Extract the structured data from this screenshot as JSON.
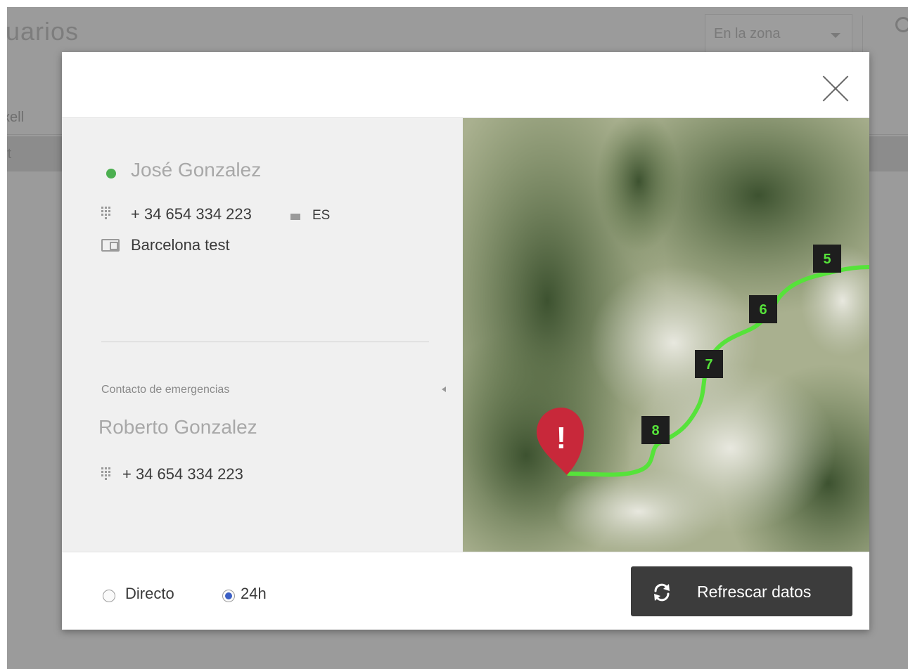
{
  "background": {
    "title": "uarios",
    "zone_select": "En la zona",
    "rows": [
      "xell",
      "rt"
    ]
  },
  "modal": {
    "user": {
      "name": "José Gonzalez",
      "status_color": "#4caf50",
      "phone": "+ 34 654 334 223",
      "country": "ES",
      "location": "Barcelona test"
    },
    "emergency": {
      "section_label": "Contacto de emergencias",
      "name": "Roberto Gonzalez",
      "phone": "+ 34 654 334 223"
    },
    "map": {
      "route_color": "#56e33a",
      "alert_color": "#c8283a",
      "alert_glyph": "!",
      "waypoints": [
        "5",
        "6",
        "7",
        "8"
      ]
    },
    "footer": {
      "options": [
        {
          "label": "Directo",
          "selected": false
        },
        {
          "label": "24h",
          "selected": true
        }
      ],
      "refresh_label": "Refrescar datos",
      "refresh_icon": "refresh-icon"
    }
  }
}
